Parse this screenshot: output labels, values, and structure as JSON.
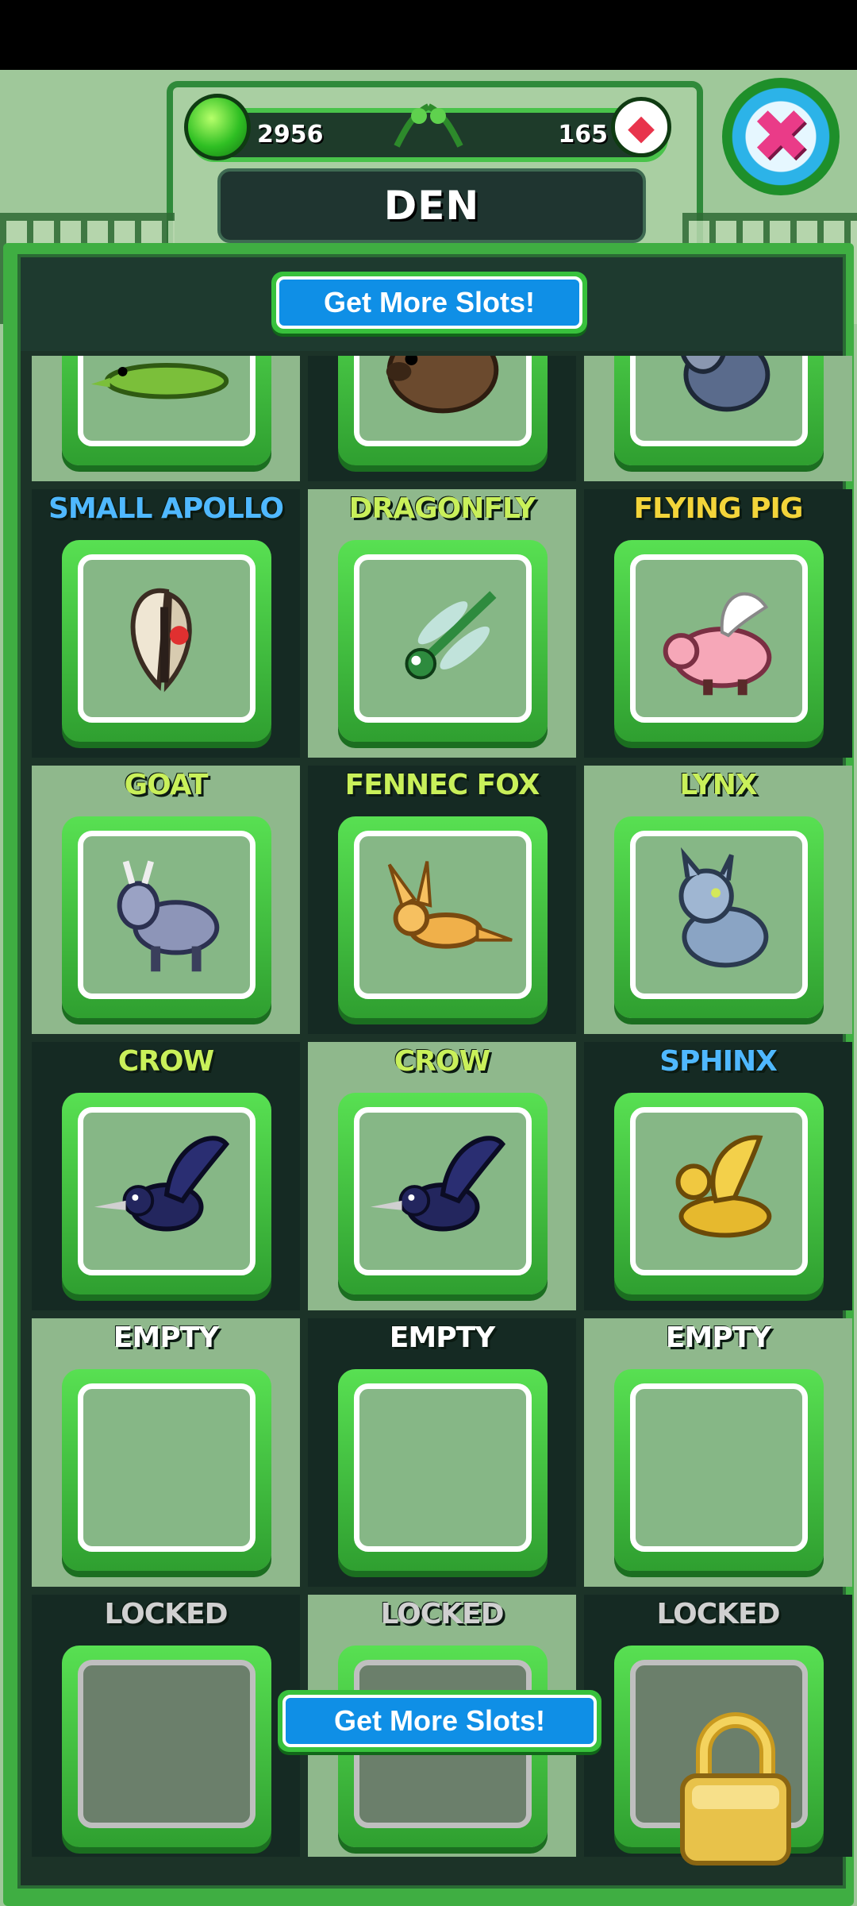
{
  "header": {
    "gems_value": "2956",
    "rubies_value": "165",
    "title": "DEN"
  },
  "buttons": {
    "get_more_slots_top": "Get More Slots!",
    "get_more_slots_bottom": "Get More Slots!"
  },
  "slots": [
    {
      "label": "",
      "color": "#ffffff",
      "icon": "crocodile-icon"
    },
    {
      "label": "",
      "color": "#ffffff",
      "icon": "wombat-icon"
    },
    {
      "label": "",
      "color": "#ffffff",
      "icon": "badger-icon"
    },
    {
      "label": "SMALL APOLLO",
      "color": "#4fb8ff",
      "icon": "butterfly-icon"
    },
    {
      "label": "DRAGONFLY",
      "color": "#c9f05a",
      "icon": "dragonfly-icon"
    },
    {
      "label": "FLYING PIG",
      "color": "#f3d43a",
      "icon": "flying-pig-icon"
    },
    {
      "label": "GOAT",
      "color": "#c9f05a",
      "icon": "goat-icon"
    },
    {
      "label": "FENNEC FOX",
      "color": "#c9f05a",
      "icon": "fennec-fox-icon"
    },
    {
      "label": "LYNX",
      "color": "#c9f05a",
      "icon": "lynx-icon"
    },
    {
      "label": "CROW",
      "color": "#c9f05a",
      "icon": "crow-icon"
    },
    {
      "label": "CROW",
      "color": "#c9f05a",
      "icon": "crow-icon"
    },
    {
      "label": "SPHINX",
      "color": "#4fb8ff",
      "icon": "sphinx-icon"
    },
    {
      "label": "EMPTY",
      "color": "#ffffff",
      "icon": ""
    },
    {
      "label": "EMPTY",
      "color": "#ffffff",
      "icon": ""
    },
    {
      "label": "EMPTY",
      "color": "#ffffff",
      "icon": ""
    },
    {
      "label": "LOCKED",
      "color": "#d0d0d0",
      "icon": ""
    },
    {
      "label": "LOCKED",
      "color": "#d0d0d0",
      "icon": ""
    },
    {
      "label": "LOCKED",
      "color": "#d0d0d0",
      "icon": ""
    }
  ]
}
